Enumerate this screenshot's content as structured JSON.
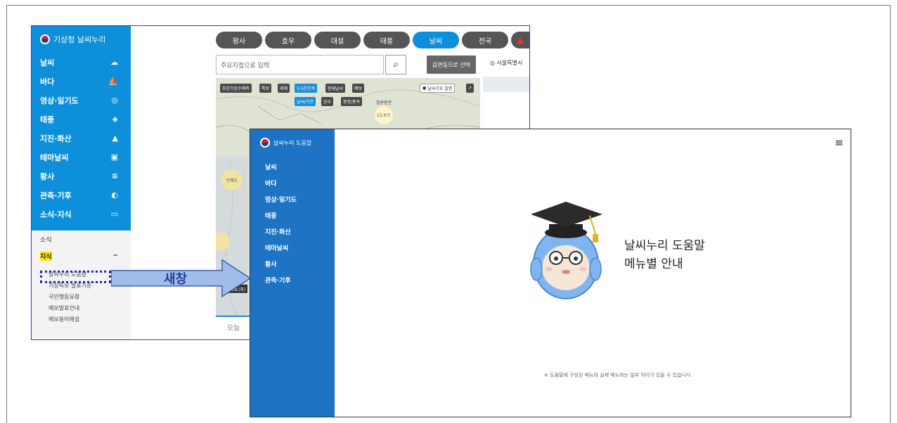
{
  "back_window": {
    "logo_text": "기상청 날씨누리",
    "menu": [
      {
        "label": "날씨",
        "icon": "cloud-sun-icon"
      },
      {
        "label": "바다",
        "icon": "wave-icon"
      },
      {
        "label": "영상·일기도",
        "icon": "satellite-icon"
      },
      {
        "label": "태풍",
        "icon": "typhoon-icon"
      },
      {
        "label": "지진·화산",
        "icon": "volcano-icon"
      },
      {
        "label": "테마날씨",
        "icon": "bag-icon"
      },
      {
        "label": "황사",
        "icon": "dust-icon"
      },
      {
        "label": "관측·기후",
        "icon": "observe-icon"
      },
      {
        "label": "소식·지식",
        "icon": "news-icon"
      }
    ],
    "submenu": {
      "news": "소식",
      "knowledge": "지식",
      "knowledge_toggle": "−",
      "items": [
        "날씨누리 도움말",
        "기상특보 발표기준",
        "국민행동요령",
        "예보발표안내",
        "예보용어해설"
      ]
    },
    "tabs": [
      "황사",
      "호우",
      "대설",
      "태풍",
      "날씨",
      "전국"
    ],
    "search_placeholder": "주요지점으로 입력",
    "select_button": "읍면동으로 선택",
    "location_text": "서울특별시",
    "map": {
      "buttons_row1": [
        "초단기강수예측",
        "특보",
        "레제",
        "1시간간격",
        "현재날씨",
        "예보"
      ],
      "buttons_row2": [
        "날씨/기온",
        "강수",
        "풍향/풍속"
      ],
      "legend_btn": "날씨기호 설명",
      "bubble_temp": "13.6℃",
      "bubble_place": "철원원권",
      "bubble2": "인해도",
      "timestamp": "03.28.(화)"
    },
    "bottom_tab": "오늘"
  },
  "arrow_label": "새창",
  "front_window": {
    "logo_text": "날씨누리 도움말",
    "menu": [
      "날씨",
      "바다",
      "영상·일기도",
      "태풍",
      "지진·화산",
      "테마날씨",
      "황사",
      "관측·기후"
    ],
    "hamburger": "≡",
    "title_line1": "날씨누리 도움말",
    "title_line2": "메뉴별 안내",
    "note": "※ 도움말에 구성된 메뉴와 실제 메뉴와는 일부 차이가 있을 수 있습니다."
  },
  "colors": {
    "sidebar_blue": "#0d8fd9",
    "help_sidebar_blue": "#1e73c4",
    "arrow_blue": "#9fbde8",
    "dotted_box": "#1a2fa8"
  }
}
